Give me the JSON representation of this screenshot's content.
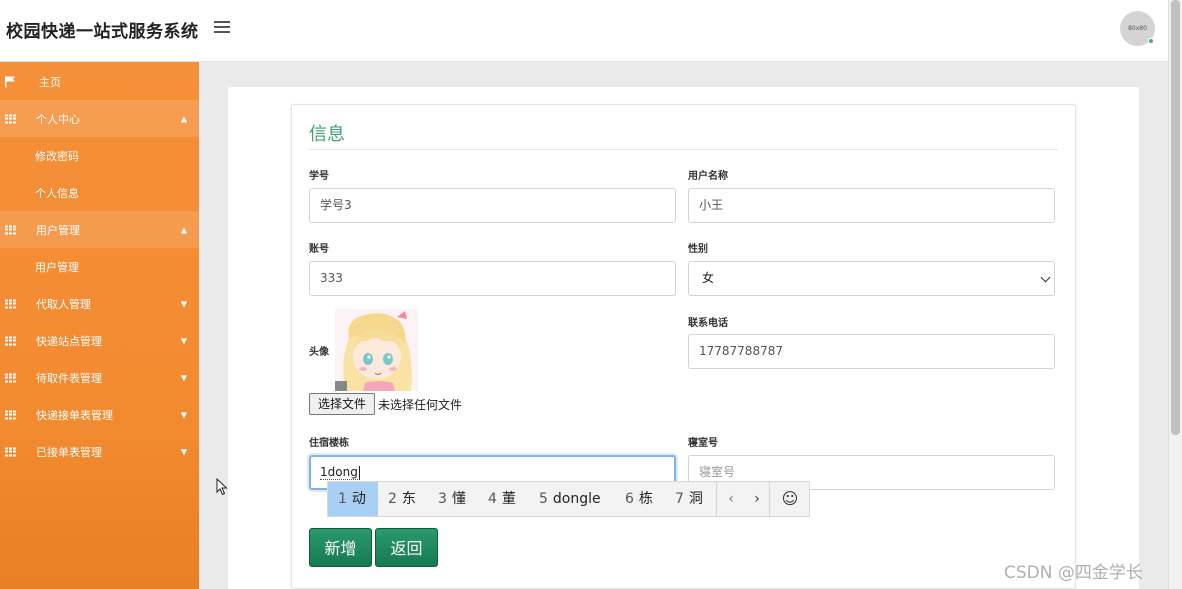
{
  "header": {
    "title": "校园快递一站式服务系统",
    "avatar_text": "80x80"
  },
  "sidebar": {
    "items": [
      {
        "label": "主页",
        "icon": "flag-icon"
      },
      {
        "label": "个人中心",
        "icon": "grid-icon",
        "expanded": true
      },
      {
        "label": "修改密码"
      },
      {
        "label": "个人信息"
      },
      {
        "label": "用户管理",
        "icon": "grid-icon",
        "expanded": true
      },
      {
        "label": "用户管理"
      },
      {
        "label": "代取人管理",
        "icon": "grid-icon"
      },
      {
        "label": "快递站点管理",
        "icon": "grid-icon"
      },
      {
        "label": "待取件表管理",
        "icon": "grid-icon"
      },
      {
        "label": "快递接单表管理",
        "icon": "grid-icon"
      },
      {
        "label": "已接单表管理",
        "icon": "grid-icon"
      }
    ]
  },
  "form": {
    "title": "信息",
    "student_id": {
      "label": "学号",
      "value": "学号3"
    },
    "username": {
      "label": "用户名称",
      "value": "小王"
    },
    "account": {
      "label": "账号",
      "value": "333"
    },
    "gender": {
      "label": "性别",
      "value": "女"
    },
    "avatar": {
      "label": "头像",
      "file_button": "选择文件",
      "file_status": "未选择任何文件"
    },
    "phone": {
      "label": "联系电话",
      "value": "17787788787"
    },
    "building": {
      "label": "住宿楼栋",
      "value": "1dong"
    },
    "room": {
      "label": "寝室号",
      "placeholder": "寝室号"
    },
    "add_button": "新增",
    "back_button": "返回"
  },
  "ime": {
    "candidates": [
      {
        "num": "1",
        "text": "动"
      },
      {
        "num": "2",
        "text": "东"
      },
      {
        "num": "3",
        "text": "懂"
      },
      {
        "num": "4",
        "text": "董"
      },
      {
        "num": "5",
        "text": "dongle"
      },
      {
        "num": "6",
        "text": "栋"
      },
      {
        "num": "7",
        "text": "洞"
      }
    ],
    "prev": "‹",
    "next": "›",
    "emoji": "☺"
  },
  "watermark": "CSDN @四金学长",
  "colors": {
    "sidebar": "#f28a2f",
    "accent": "#3fa177",
    "button": "#1d8a5e"
  }
}
